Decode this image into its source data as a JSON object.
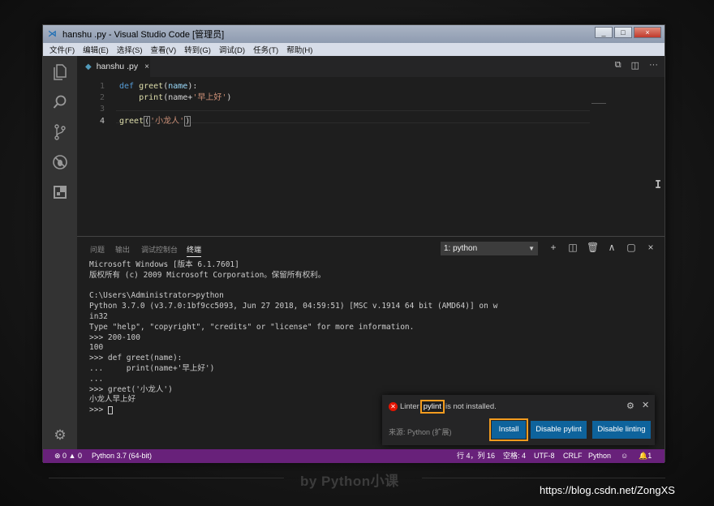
{
  "window": {
    "title": "hanshu .py - Visual Studio Code [管理员]",
    "controls": [
      "_",
      "□",
      "×"
    ]
  },
  "menu": [
    "文件(F)",
    "编辑(E)",
    "选择(S)",
    "查看(V)",
    "转到(G)",
    "调试(D)",
    "任务(T)",
    "帮助(H)"
  ],
  "activity_icons": [
    "files-icon",
    "search-icon",
    "source-control-icon",
    "debug-icon",
    "extensions-icon",
    "settings-icon"
  ],
  "tab": {
    "label": "hanshu .py",
    "close": "×"
  },
  "editor": {
    "lines": [
      {
        "n": "1",
        "tokens": [
          [
            "kw",
            "def "
          ],
          [
            "fn",
            "greet"
          ],
          [
            "",
            "("
          ],
          [
            "pm",
            "name"
          ],
          [
            "",
            "):"
          ]
        ]
      },
      {
        "n": "2",
        "tokens": [
          [
            "",
            "    "
          ],
          [
            "fn",
            "print"
          ],
          [
            "",
            "(name+"
          ],
          [
            "st",
            "'早上好'"
          ],
          [
            "",
            ")"
          ]
        ]
      },
      {
        "n": "3",
        "tokens": []
      },
      {
        "n": "4",
        "tokens": [
          [
            "fn",
            "greet"
          ],
          [
            "br",
            "("
          ],
          [
            "st",
            "'小龙人'"
          ],
          [
            "br",
            ")"
          ]
        ]
      }
    ]
  },
  "panel": {
    "tabs": [
      "问题",
      "输出",
      "调试控制台",
      "终端"
    ],
    "active_tab": "终端",
    "terminal_select": "1: python",
    "icons": [
      "+",
      "◫",
      "🗑",
      "∧",
      "▢",
      "×"
    ]
  },
  "terminal": [
    "Microsoft Windows [版本 6.1.7601]",
    "版权所有 (c) 2009 Microsoft Corporation。保留所有权利。",
    "",
    "C:\\Users\\Administrator>python",
    "Python 3.7.0 (v3.7.0:1bf9cc5093, Jun 27 2018, 04:59:51) [MSC v.1914 64 bit (AMD64)] on w",
    "in32",
    "Type \"help\", \"copyright\", \"credits\" or \"license\" for more information.",
    ">>> 200-100",
    "100",
    ">>> def greet(name):",
    "...     print(name+'早上好')",
    "...",
    ">>> greet('小龙人')",
    "小龙人早上好",
    ">>> "
  ],
  "notification": {
    "msg_before": "Linter",
    "msg_highlight": "pylint",
    "msg_after": "is not installed.",
    "source": "来源: Python (扩展)",
    "buttons": [
      "Install",
      "Disable pylint",
      "Disable linting"
    ]
  },
  "status": {
    "problems": "⊗ 0 ▲ 0",
    "interpreter": "Python 3.7 (64-bit)",
    "position": "行 4，列 16",
    "spaces": "空格: 4",
    "encoding": "UTF-8",
    "eol": "CRLF",
    "language": "Python",
    "smiley": "☺",
    "bell": "🔔1"
  },
  "watermark": "by Python小课",
  "url": "https://blog.csdn.net/ZongXS",
  "colors": {
    "statusbar": "#68217a",
    "button": "#0e639c",
    "highlight": "#f39c1f"
  }
}
